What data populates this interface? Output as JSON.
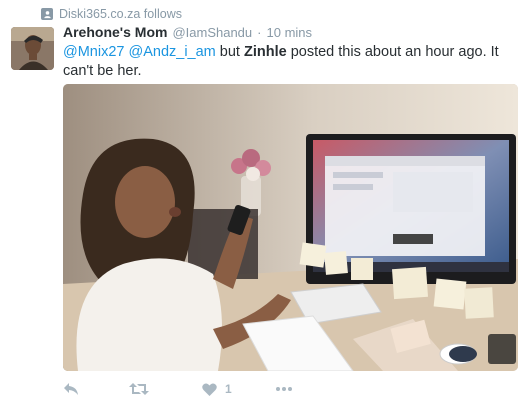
{
  "context": {
    "icon": "follow-person-icon",
    "text": "Diski365.co.za follows"
  },
  "tweet": {
    "fullname": "Arehone's Mom",
    "screenname": "@IamShandu",
    "separator": "·",
    "time": "10 mins",
    "mention1": "@Mnix27",
    "mention2": "@Andz_i_am",
    "text_part1": " but ",
    "text_bold": "Zinhle",
    "text_part2": " posted this about an hour ago. It can't be her."
  },
  "actions": {
    "reply_icon": "reply-icon",
    "retweet_icon": "retweet-icon",
    "like_icon": "heart-icon",
    "like_count": "1",
    "more_icon": "more-dots-icon"
  },
  "colors": {
    "link": "#1b95e0",
    "muted": "#8899a6",
    "action": "#aab8c2",
    "text": "#292f33"
  }
}
